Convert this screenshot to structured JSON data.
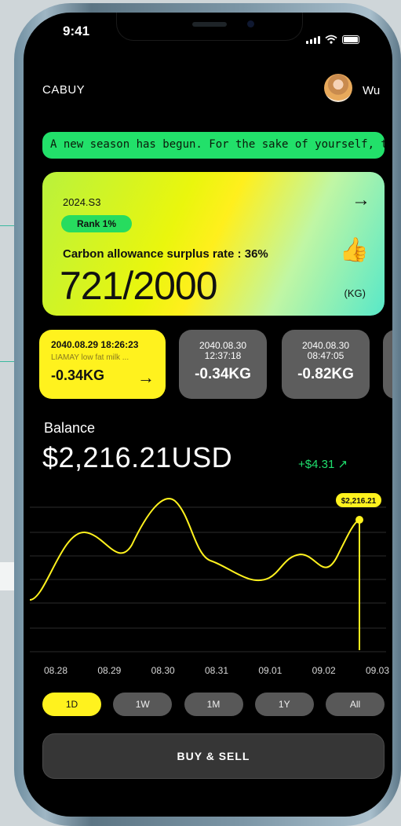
{
  "status_bar": {
    "time": "9:41"
  },
  "header": {
    "app_name": "CABUY",
    "user_name": "Wu"
  },
  "ticker": {
    "text": "A new season has begun. For the sake of yourself, the Earth"
  },
  "rank_card": {
    "season": "2024.S3",
    "rank": "Rank 1%",
    "surplus_label": "Carbon allowance surplus rate : 36%",
    "allowance": "721/2000",
    "unit": "(KG)",
    "icon": "thumbs-up-icon"
  },
  "transactions": [
    {
      "date": "2040.08.29 18:26:23",
      "description": "LIAMAY low fat milk ...",
      "amount": "-0.34KG"
    },
    {
      "date": "2040.08.30",
      "time": "12:37:18",
      "amount": "-0.34KG"
    },
    {
      "date": "2040.08.30",
      "time": "08:47:05",
      "amount": "-0.82KG"
    }
  ],
  "balance": {
    "label": "Balance",
    "value": "$2,216.21USD",
    "change": "+$4.31 ↗"
  },
  "chart_data": {
    "type": "line",
    "categories": [
      "08.28",
      "08.29",
      "08.30",
      "08.31",
      "09.01",
      "09.02",
      "09.03"
    ],
    "tooltip": "$2,216.21",
    "grid": true,
    "line_color": "#fff21e"
  },
  "ranges": [
    {
      "label": "1D",
      "active": true
    },
    {
      "label": "1W",
      "active": false
    },
    {
      "label": "1M",
      "active": false
    },
    {
      "label": "1Y",
      "active": false
    },
    {
      "label": "All",
      "active": false
    }
  ],
  "actions": {
    "buy_sell": "BUY & SELL"
  },
  "colors": {
    "accent": "#fff21e",
    "green": "#22e06a",
    "positive": "#1fe06e"
  }
}
